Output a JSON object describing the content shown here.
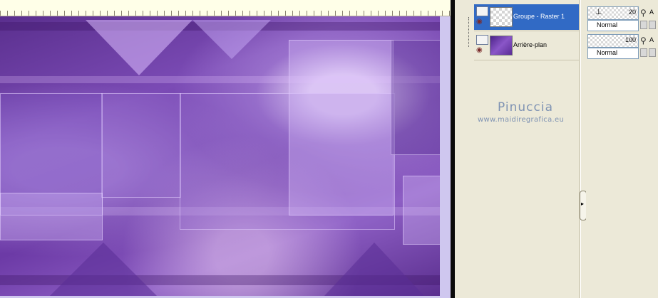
{
  "layers": [
    {
      "name": "Groupe - Raster 1",
      "selected": true,
      "opacity": "20",
      "blend_mode": "Normal",
      "thumbnail": "transparent-checker",
      "visibility_icon": "eye-icon",
      "extra_label": "A"
    },
    {
      "name": "Arrière-plan",
      "selected": false,
      "opacity": "100",
      "blend_mode": "Normal",
      "thumbnail": "purple-image",
      "visibility_icon": "eye-icon",
      "extra_label": "A"
    }
  ],
  "watermark": {
    "title": "Pinuccia",
    "url": "www.maidiregrafica.eu",
    "color": "#7f93b3"
  },
  "palette": {
    "selection_color": "#316ac5",
    "panel_bg": "#ece9d8"
  },
  "icons": {
    "splitter_arrow": "▸",
    "eye": "◉",
    "opacity_marker": "⊥",
    "lock": "⚲"
  }
}
